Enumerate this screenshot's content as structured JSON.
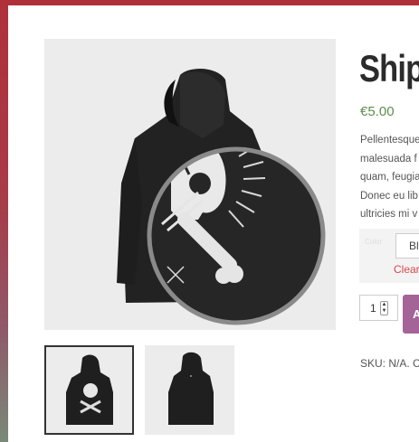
{
  "product": {
    "title": "Ship",
    "price": "€5.00",
    "description_lines": [
      "Pellentesque",
      "malesuada f",
      "quam, feugia",
      "Donec eu lib",
      "ultricies mi v"
    ],
    "variation": {
      "label": "Color",
      "selected": "Bl",
      "clear_label": "Clear"
    },
    "quantity": "1",
    "add_to_cart_label": "A",
    "sku_text": "SKU: N/A. C"
  },
  "gallery": {
    "main_image": "hoodie-front-zoomed",
    "thumbnails": [
      "hoodie-front",
      "hoodie-back"
    ]
  },
  "colors": {
    "price": "#5d8d4b",
    "clear": "#d9474c",
    "button": "#a46497"
  }
}
